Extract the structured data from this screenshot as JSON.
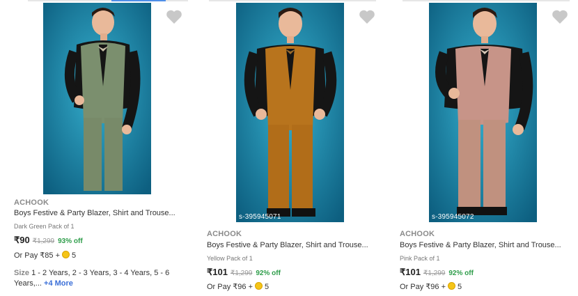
{
  "products": [
    {
      "brand": "ACHOOK",
      "title": "Boys Festive & Party Blazer, Shirt and Trouse...",
      "variant": "Dark Green Pack of 1",
      "price": "₹90",
      "mrp": "₹1,299",
      "discount": "93% off",
      "pay_prefix": "Or Pay ₹85 +",
      "coins": "5",
      "sku": "",
      "size_label": "Size",
      "size_text": "1 - 2 Years, 2 - 3 Years, 3 - 4 Years, 5 - 6 Years,...",
      "size_more": "+4 More",
      "colors": {
        "blazer": "#7b8f6e",
        "trouser": "#788a69",
        "bg": "#1f8fb1"
      }
    },
    {
      "brand": "ACHOOK",
      "title": "Boys Festive & Party Blazer, Shirt and Trouse...",
      "variant": "Yellow Pack of 1",
      "price": "₹101",
      "mrp": "₹1,299",
      "discount": "92% off",
      "pay_prefix": "Or Pay ₹96 +",
      "coins": "5",
      "sku": "s-395945071",
      "colors": {
        "blazer": "#b8741d",
        "trouser": "#b16d19",
        "bg": "#1f8fb1"
      }
    },
    {
      "brand": "ACHOOK",
      "title": "Boys Festive & Party Blazer, Shirt and Trouse...",
      "variant": "Pink Pack of 1",
      "price": "₹101",
      "mrp": "₹1,299",
      "discount": "92% off",
      "pay_prefix": "Or Pay ₹96 +",
      "coins": "5",
      "sku": "s-395945072",
      "colors": {
        "blazer": "#c79488",
        "trouser": "#c0917f",
        "bg": "#1f8fb1"
      }
    }
  ],
  "icons": {
    "wishlist": "heart-icon",
    "coin": "coin-icon"
  }
}
